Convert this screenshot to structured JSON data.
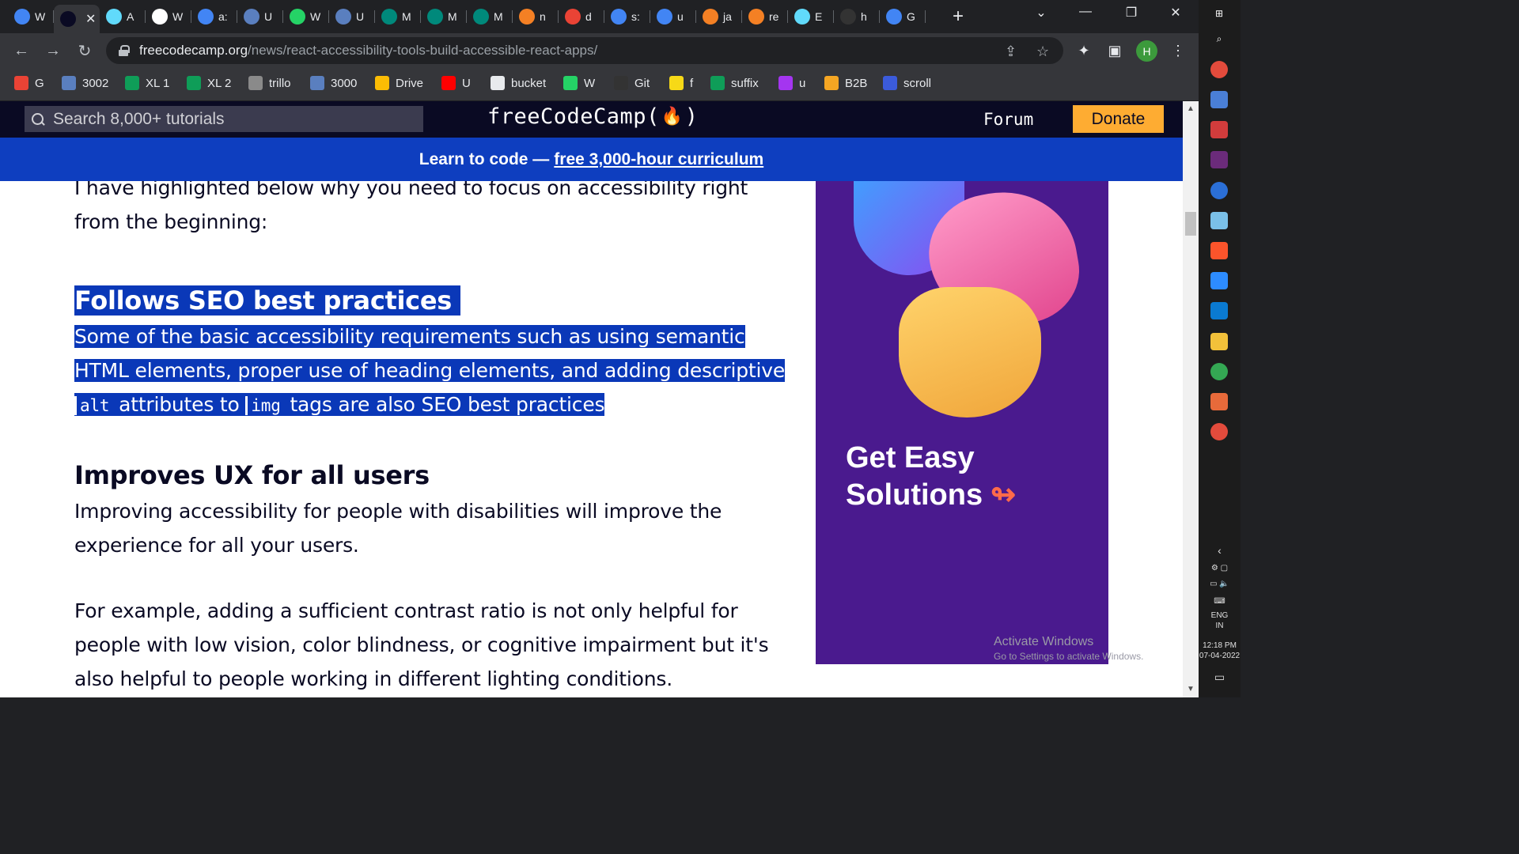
{
  "tabs": [
    {
      "label": "W",
      "icon": "google-icon",
      "color": "#4285f4"
    },
    {
      "label": "",
      "icon": "freecodecamp-icon",
      "color": "#0a0a23",
      "active": true
    },
    {
      "label": "A",
      "icon": "react-icon",
      "color": "#61dafb"
    },
    {
      "label": "W",
      "icon": "w3schools-icon",
      "color": "#ffffff"
    },
    {
      "label": "a:",
      "icon": "google-icon",
      "color": "#4285f4"
    },
    {
      "label": "U",
      "icon": "bookmark-app-icon",
      "color": "#5a7fbf"
    },
    {
      "label": "W",
      "icon": "whatsapp-icon",
      "color": "#25d366"
    },
    {
      "label": "U",
      "icon": "bookmark-app-icon",
      "color": "#5a7fbf"
    },
    {
      "label": "M",
      "icon": "meet-icon",
      "color": "#00897b"
    },
    {
      "label": "M",
      "icon": "meet-icon",
      "color": "#00897b"
    },
    {
      "label": "M",
      "icon": "meet-icon",
      "color": "#00897b"
    },
    {
      "label": "n",
      "icon": "stackoverflow-icon",
      "color": "#f48024"
    },
    {
      "label": "d",
      "icon": "gmail-icon",
      "color": "#ea4335"
    },
    {
      "label": "s:",
      "icon": "google-icon",
      "color": "#4285f4"
    },
    {
      "label": "u",
      "icon": "google-icon",
      "color": "#4285f4"
    },
    {
      "label": "ja",
      "icon": "stackoverflow-icon",
      "color": "#f48024"
    },
    {
      "label": "re",
      "icon": "stackoverflow-icon",
      "color": "#f48024"
    },
    {
      "label": "E",
      "icon": "react-icon",
      "color": "#61dafb"
    },
    {
      "label": "h",
      "icon": "github-icon",
      "color": "#333333"
    },
    {
      "label": "G",
      "icon": "google-icon",
      "color": "#4285f4"
    }
  ],
  "address_bar": {
    "host": "freecodecamp.org",
    "path": "/news/react-accessibility-tools-build-accessible-react-apps/"
  },
  "bookmarks": [
    {
      "label": "G",
      "icon": "gmail-icon",
      "color": "#ea4335"
    },
    {
      "label": "3002",
      "icon": "bookmark-app-icon",
      "color": "#5a7fbf"
    },
    {
      "label": "XL 1",
      "icon": "sheets-plus-icon",
      "color": "#0f9d58"
    },
    {
      "label": "XL 2",
      "icon": "sheets-plus-icon",
      "color": "#0f9d58"
    },
    {
      "label": "trillo",
      "icon": "trello-icon",
      "color": "#8a8a8a"
    },
    {
      "label": "3000",
      "icon": "bookmark-app-icon",
      "color": "#5a7fbf"
    },
    {
      "label": "Drive",
      "icon": "drive-icon",
      "color": "#fbbc04"
    },
    {
      "label": "U",
      "icon": "youtube-icon",
      "color": "#ff0000"
    },
    {
      "label": "bucket",
      "icon": "globe-icon",
      "color": "#e8eaed"
    },
    {
      "label": "W",
      "icon": "whatsapp-icon",
      "color": "#25d366"
    },
    {
      "label": "Git",
      "icon": "github-icon",
      "color": "#333333"
    },
    {
      "label": "f",
      "icon": "flipkart-icon",
      "color": "#f7d917"
    },
    {
      "label": "suffix",
      "icon": "sheets-plus-icon",
      "color": "#0f9d58"
    },
    {
      "label": "u",
      "icon": "udemy-icon",
      "color": "#a435f0"
    },
    {
      "label": "B2B",
      "icon": "b2b-icon",
      "color": "#f5a623"
    },
    {
      "label": "scroll",
      "icon": "p-icon",
      "color": "#3b5bdb"
    }
  ],
  "fcc": {
    "search_placeholder": "Search 8,000+ tutorials",
    "logo": "freeCodeCamp(",
    "logo_end": ")",
    "forum": "Forum",
    "donate": "Donate",
    "banner_prefix": "Learn to code —",
    "banner_link": "free 3,000-hour curriculum"
  },
  "article": {
    "intro": "I have highlighted below why you need to focus on accessibility right from the beginning:",
    "seo_heading": "Follows SEO best practices",
    "seo_p1": "Some of the basic accessibility requirements such as using semantic HTML elements, proper use of heading elements, and adding descriptive ",
    "seo_code1": "alt",
    "seo_p2": " attributes to ",
    "seo_code2": "img",
    "seo_p3": " tags are also SEO best practices",
    "ux_heading": "Improves UX for all users",
    "ux_p": "Improving accessibility for people with disabilities will improve the experience for all your users.",
    "example_p": "For example, adding a sufficient contrast ratio is not only helpful for people with low vision, color blindness, or cognitive impairment but it's also helpful to people working in different lighting conditions."
  },
  "ad": {
    "line1": "Get Easy",
    "line2": "Solutions",
    "arrow": "↬"
  },
  "watermark": {
    "title": "Activate Windows",
    "sub": "Go to Settings to activate Windows."
  },
  "system_tray": {
    "lang": "ENG",
    "region": "IN",
    "time": "12:18 PM",
    "date": "07-04-2022"
  }
}
